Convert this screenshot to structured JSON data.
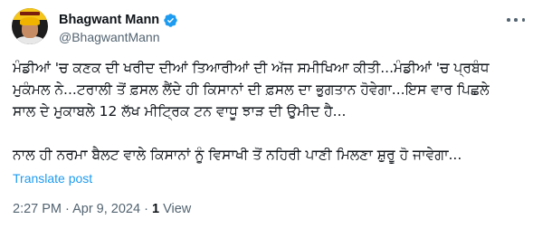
{
  "author": {
    "display_name": "Bhagwant Mann",
    "handle": "@BhagwantMann",
    "verified": true,
    "verified_color": "#1d9bf0"
  },
  "tweet": {
    "lines": [
      "ਮੰਡੀਆਂ 'ਚ ਕਣਕ ਦੀ ਖਰੀਦ ਦੀਆਂ ਤਿਆਰੀਆਂ ਦੀ ਅੱਜ ਸਮੀਖਿਆ ਕੀਤੀ...ਮੰਡੀਆਂ 'ਚ ਪ੍ਰਬੰਧ",
      "ਮੁਕੰਮਲ ਨੇ...ਟਰਾਲੀ ਤੋਂ ਫ਼ਸਲ ਲੈਂਦੇ ਹੀ ਕਿਸਾਨਾਂ ਦੀ ਫ਼ਸਲ ਦਾ ਭੁਗਤਾਨ ਹੋਵੇਗਾ...ਇਸ ਵਾਰ ਪਿਛਲੇ",
      "ਸਾਲ ਦੇ ਮੁਕਾਬਲੇ 12 ਲੱਖ ਮੀਟ੍ਰਿਕ ਟਨ ਵਾਧੂ ਝਾੜ ਦੀ ਉਮੀਦ ਹੈ...",
      "ਨਾਲ ਹੀ ਨਰਮਾ ਬੈਲਟ ਵਾਲੇ ਕਿਸਾਨਾਂ ਨੂੰ ਵਿਸਾਖੀ ਤੋਂ ਨਹਿਰੀ ਪਾਣੀ ਮਿਲਣਾ ਸ਼ੁਰੂ ਹੋ ਜਾਵੇਗਾ..."
    ],
    "translate_label": "Translate post",
    "time": "2:27 PM",
    "date": "Apr 9, 2024",
    "separator": " · ",
    "views_count": "1",
    "views_label": " View"
  },
  "icons": {
    "more": "more-horizontal-icon",
    "verified": "verified-badge-icon"
  }
}
